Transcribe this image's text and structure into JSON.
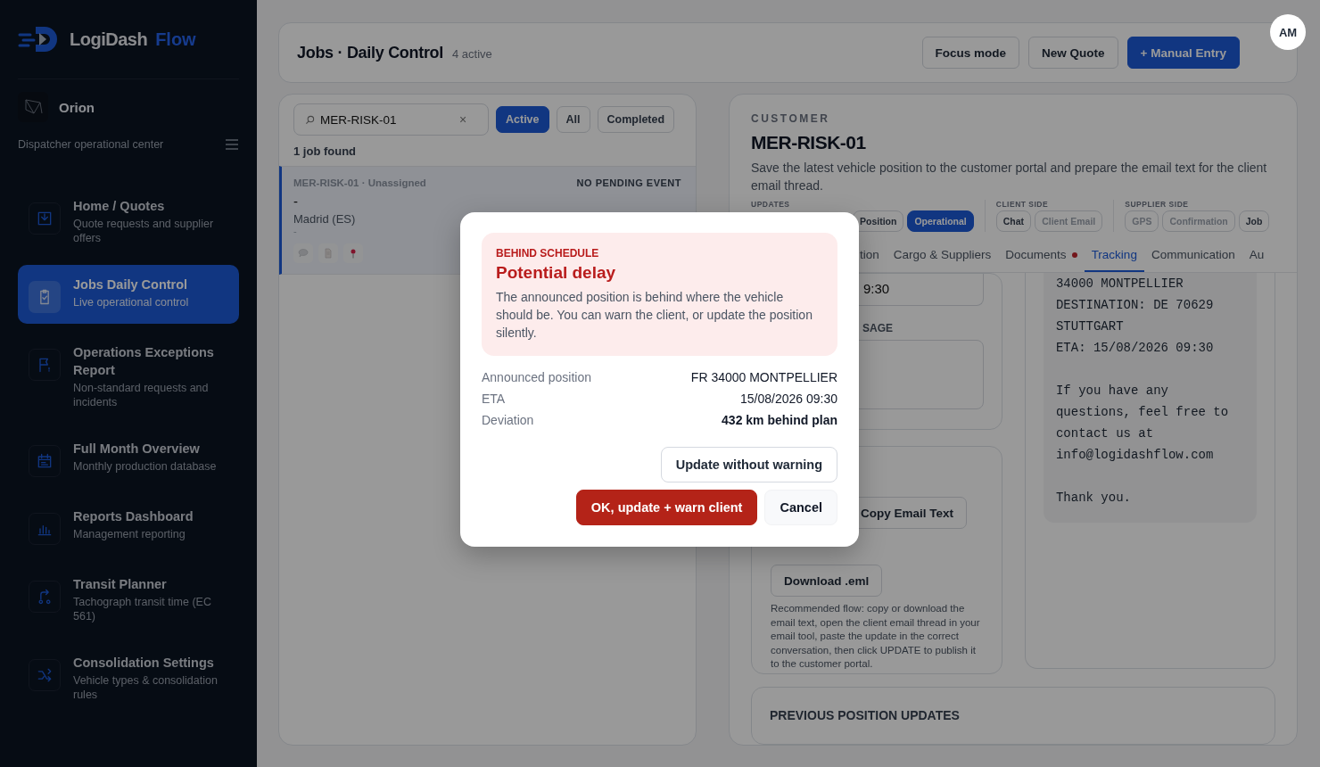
{
  "sidebar": {
    "logo": {
      "word": "LogiDash",
      "accent": "Flow"
    },
    "workspace": {
      "name": "Orion",
      "subtitle": "Dispatcher operational center"
    },
    "items": [
      {
        "title": "Home / Quotes",
        "subtitle": "Quote requests and supplier offers",
        "selected": false
      },
      {
        "title": "Jobs Daily Control",
        "subtitle": "Live operational control",
        "selected": true
      },
      {
        "title": "Operations Exceptions Report",
        "subtitle": "Non-standard requests and incidents",
        "selected": false
      },
      {
        "title": "Full Month Overview",
        "subtitle": "Monthly production database",
        "selected": false
      },
      {
        "title": "Reports Dashboard",
        "subtitle": "Management reporting",
        "selected": false
      },
      {
        "title": "Transit Planner",
        "subtitle": "Tachograph transit time (EC 561)",
        "selected": false
      },
      {
        "title": "Consolidation Settings",
        "subtitle": "Vehicle types & consolidation rules",
        "selected": false
      }
    ]
  },
  "header": {
    "title": "Jobs · Daily Control",
    "count": "4 active",
    "buttons": [
      {
        "label": "Focus mode",
        "kind": "outline"
      },
      {
        "label": "New Quote",
        "kind": "outline"
      },
      {
        "label": "+ Manual Entry",
        "kind": "primary"
      }
    ]
  },
  "avatar": "AM",
  "jobs": {
    "search": {
      "value": "MER-RISK-01",
      "clear": "×"
    },
    "filters": [
      {
        "label": "Active",
        "selected": true
      },
      {
        "label": "All",
        "selected": false
      },
      {
        "label": "Completed",
        "selected": false
      }
    ],
    "found": "1 job found",
    "cards": [
      {
        "ref": "MER-RISK-01 · Unassigned",
        "status": "NO PENDING EVENT",
        "route": "-",
        "origin": "Madrid (ES)",
        "extra": "-",
        "selected": true
      }
    ]
  },
  "detail": {
    "kicker": "CUSTOMER",
    "title": "MER-RISK-01",
    "description": "Save the latest vehicle position to the customer portal and prepare the email text for the client email thread.",
    "groups": [
      {
        "label": "UPDATES",
        "chips": [
          {
            "label": "Position",
            "selected": false,
            "disabled": false
          },
          {
            "label": "Operational",
            "selected": true,
            "disabled": false
          }
        ]
      },
      {
        "label": "CLIENT SIDE",
        "chips": [
          {
            "label": "Chat",
            "selected": false,
            "disabled": false
          },
          {
            "label": "Client Email",
            "selected": false,
            "disabled": true
          }
        ]
      },
      {
        "label": "SUPPLIER SIDE",
        "chips": [
          {
            "label": "GPS",
            "selected": false,
            "disabled": true
          },
          {
            "label": "Confirmation",
            "selected": false,
            "disabled": true
          },
          {
            "label": "Job",
            "selected": false,
            "disabled": false
          }
        ]
      }
    ],
    "tabs": [
      {
        "label": "tion",
        "selected": false,
        "alert": false
      },
      {
        "label": "Cargo & Suppliers",
        "selected": false,
        "alert": false
      },
      {
        "label": "Documents",
        "selected": false,
        "alert": true
      },
      {
        "label": "Tracking",
        "selected": true,
        "alert": false
      },
      {
        "label": "Communication",
        "selected": false,
        "alert": false
      },
      {
        "label": "Au",
        "selected": false,
        "alert": false
      }
    ],
    "eta_field": {
      "value": "9:30"
    },
    "message_label": "SAGE",
    "actions": [
      "Copy Email Text",
      "Download .eml"
    ],
    "flow_note": "Recommended flow: copy or download the email text, open the client email thread in your email tool, paste the update in the correct conversation, then click UPDATE to publish it to the customer portal.",
    "email_preview": "34000 MONTPELLIER\nDESTINATION: DE 70629\nSTUTTGART\nETA: 15/08/2026 09:30\n\nIf you have any\nquestions, feel free to\ncontact us at\ninfo@logidashflow.com\n\nThank you.",
    "history_title": "PREVIOUS POSITION UPDATES"
  },
  "dialog": {
    "kicker": "BEHIND SCHEDULE",
    "title": "Potential delay",
    "message": "The announced position is behind where the vehicle should be. You can warn the client, or update the position silently.",
    "rows": [
      {
        "label": "Announced position",
        "value": "FR 34000 MONTPELLIER",
        "strong": false
      },
      {
        "label": "ETA",
        "value": "15/08/2026 09:30",
        "strong": false
      },
      {
        "label": "Deviation",
        "value": "432 km behind plan",
        "strong": true
      }
    ],
    "buttons": [
      {
        "label": "Update without warning",
        "kind": "outline"
      },
      {
        "label": "OK, update + warn client",
        "kind": "danger"
      },
      {
        "label": "Cancel",
        "kind": "plain"
      }
    ]
  }
}
